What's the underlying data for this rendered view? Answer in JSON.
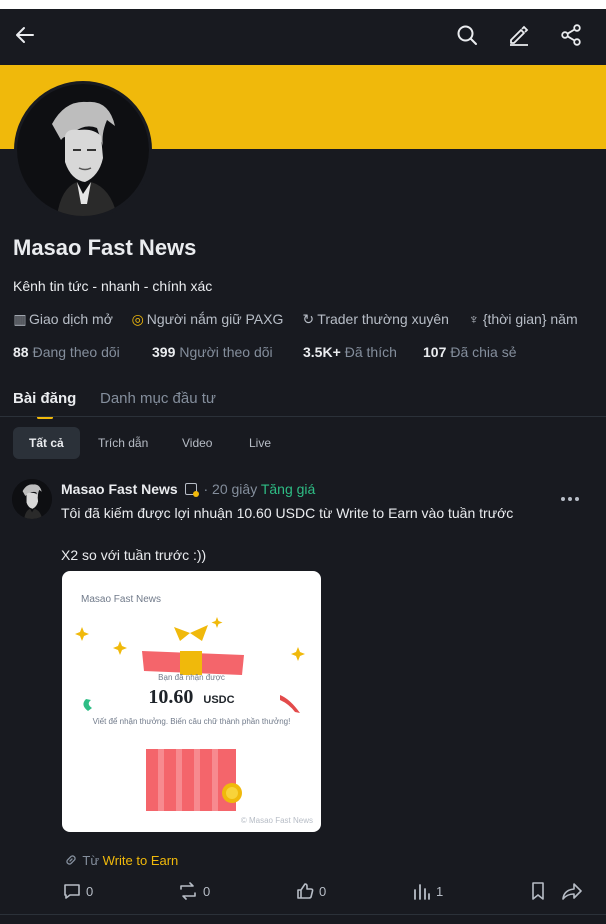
{
  "header": {
    "icons": [
      "back-arrow-icon",
      "search-icon",
      "edit-icon",
      "share-icon"
    ]
  },
  "profile": {
    "name": "Masao Fast News",
    "bio": "Kênh tin tức - nhanh - chính xác",
    "badges": [
      {
        "icon": "chart-icon",
        "label": "Giao dịch mở"
      },
      {
        "icon": "coin-icon",
        "label": "Người nắm giữ PAXG"
      },
      {
        "icon": "refresh-icon",
        "label": "Trader thường xuyên"
      },
      {
        "icon": "sprout-icon",
        "label": "{thời gian} năm"
      }
    ],
    "stats": [
      {
        "value": "88",
        "label": "Đang theo dõi"
      },
      {
        "value": "399",
        "label": "Người theo dõi"
      },
      {
        "value": "3.5K+",
        "label": "Đã thích"
      },
      {
        "value": "107",
        "label": "Đã chia sẻ"
      }
    ]
  },
  "tabs": [
    {
      "label": "Bài đăng",
      "active": true
    },
    {
      "label": "Danh mục đầu tư",
      "active": false
    }
  ],
  "filters": [
    {
      "label": "Tất cả",
      "active": true
    },
    {
      "label": "Trích dẫn",
      "active": false
    },
    {
      "label": "Video",
      "active": false
    },
    {
      "label": "Live",
      "active": false
    }
  ],
  "post": {
    "author": "Masao Fast News",
    "time": "· 20 giây",
    "tag": "Tăng giá",
    "text": "Tôi đã kiếm được lợi nhuận 10.60 USDC từ Write to Earn vào tuần trước\n\nX2 so với tuần trước :))",
    "card": {
      "title": "Masao Fast News",
      "received_label": "Bạn đã nhận được",
      "amount": "10.60",
      "currency": "USDC",
      "subtitle": "Viết để nhận thưởng. Biến câu chữ thành phần thưởng!",
      "watermark": "© Masao Fast News"
    },
    "source_prefix": "Từ",
    "source_link": "Write to Earn",
    "actions": {
      "comments": "0",
      "reposts": "0",
      "likes": "0",
      "views": "1"
    }
  },
  "colors": {
    "background": "#181a20",
    "accent": "#f0b90b",
    "bullish": "#2ebd85",
    "muted": "#848e9c"
  }
}
